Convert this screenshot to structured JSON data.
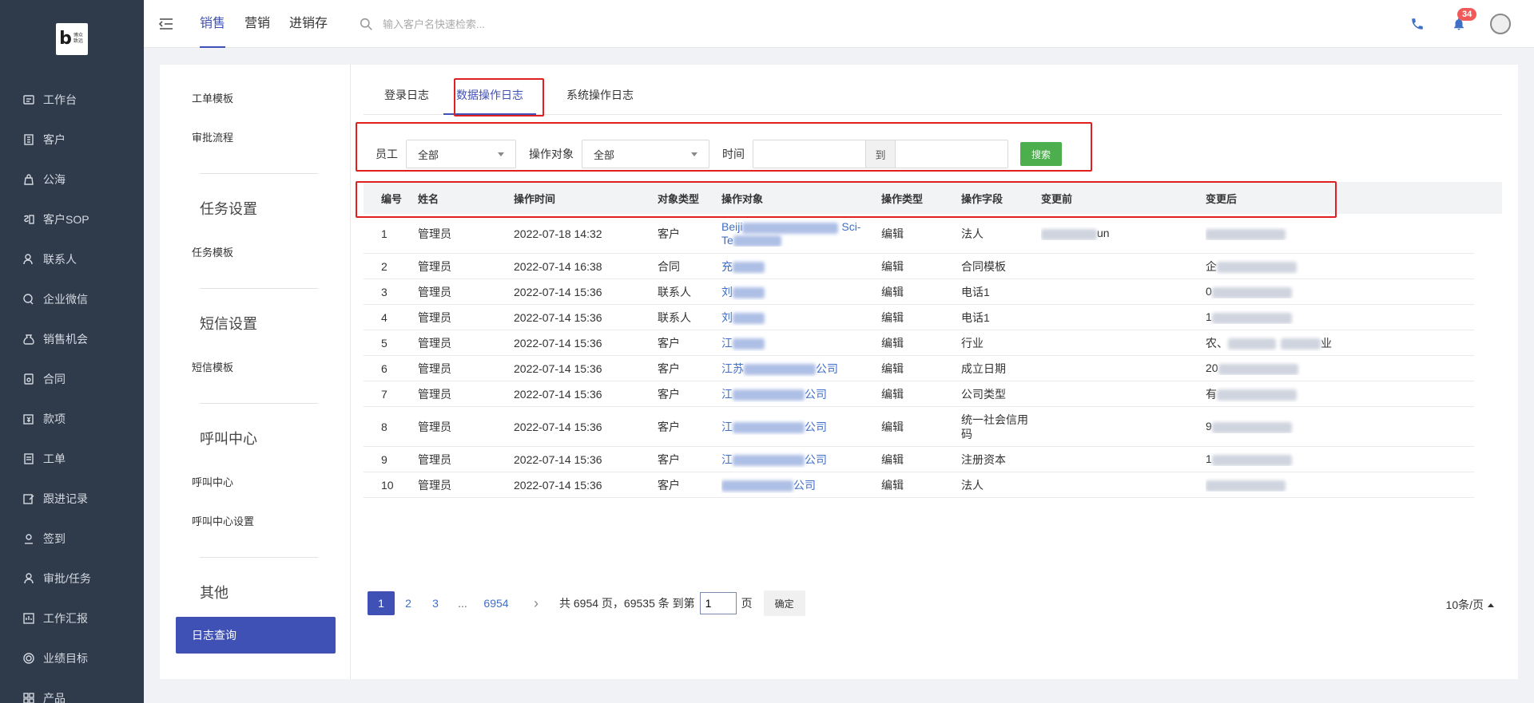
{
  "logo": {
    "letter": "b",
    "text": "博众致远"
  },
  "sidebar": {
    "items": [
      {
        "label": "工作台",
        "icon": "dashboard-icon"
      },
      {
        "label": "客户",
        "icon": "building-icon"
      },
      {
        "label": "公海",
        "icon": "bag-icon"
      },
      {
        "label": "客户SOP",
        "icon": "sop-icon"
      },
      {
        "label": "联系人",
        "icon": "person-icon"
      },
      {
        "label": "企业微信",
        "icon": "chat-icon"
      },
      {
        "label": "销售机会",
        "icon": "money-bag-icon"
      },
      {
        "label": "合同",
        "icon": "contract-icon"
      },
      {
        "label": "款项",
        "icon": "payment-icon"
      },
      {
        "label": "工单",
        "icon": "ticket-icon"
      },
      {
        "label": "跟进记录",
        "icon": "edit-icon"
      },
      {
        "label": "签到",
        "icon": "checkin-icon"
      },
      {
        "label": "审批/任务",
        "icon": "approval-icon"
      },
      {
        "label": "工作汇报",
        "icon": "report-icon"
      },
      {
        "label": "业绩目标",
        "icon": "target-icon"
      },
      {
        "label": "产品",
        "icon": "product-icon"
      }
    ]
  },
  "header": {
    "tabs": [
      "销售",
      "营销",
      "进销存"
    ],
    "active_tab": "销售",
    "search_placeholder": "输入客户名快速检索...",
    "notification_count": "34"
  },
  "submenu": {
    "links": {
      "work_order_template": "工单模板",
      "approval_flow": "审批流程",
      "task_template": "任务模板",
      "sms_template": "短信模板",
      "call_center": "呼叫中心",
      "call_center_settings": "呼叫中心设置"
    },
    "sections": {
      "task": "任务设置",
      "sms": "短信设置",
      "call": "呼叫中心",
      "other": "其他"
    },
    "active": "日志查询"
  },
  "log_tabs": [
    "登录日志",
    "数据操作日志",
    "系统操作日志"
  ],
  "filter": {
    "employee_label": "员工",
    "employee_value": "全部",
    "object_label": "操作对象",
    "object_value": "全部",
    "time_label": "时间",
    "to_label": "到",
    "search_button": "搜索"
  },
  "table": {
    "columns": [
      "编号",
      "姓名",
      "操作时间",
      "对象类型",
      "操作对象",
      "操作类型",
      "操作字段",
      "变更前",
      "变更后"
    ],
    "rows": [
      {
        "id": "1",
        "name": "管理员",
        "time": "2022-07-18 14:32",
        "obj_type": "客户",
        "obj_a": "Beiji",
        "obj_b": "Sci-",
        "obj_c": "Te",
        "op": "编辑",
        "field": "法人",
        "before": "un",
        "after": ""
      },
      {
        "id": "2",
        "name": "管理员",
        "time": "2022-07-14 16:38",
        "obj_type": "合同",
        "obj_a": "充",
        "obj_b": "",
        "obj_c": "",
        "op": "编辑",
        "field": "合同模板",
        "before": "",
        "after": "企"
      },
      {
        "id": "3",
        "name": "管理员",
        "time": "2022-07-14 15:36",
        "obj_type": "联系人",
        "obj_a": "刘",
        "obj_b": "",
        "obj_c": "",
        "op": "编辑",
        "field": "电话1",
        "before": "",
        "after": "0"
      },
      {
        "id": "4",
        "name": "管理员",
        "time": "2022-07-14 15:36",
        "obj_type": "联系人",
        "obj_a": "刘",
        "obj_b": "",
        "obj_c": "",
        "op": "编辑",
        "field": "电话1",
        "before": "",
        "after": "1"
      },
      {
        "id": "5",
        "name": "管理员",
        "time": "2022-07-14 15:36",
        "obj_type": "客户",
        "obj_a": "江",
        "obj_b": "",
        "obj_c": "",
        "op": "编辑",
        "field": "行业",
        "before": "",
        "after": "农、",
        "after_tail": "业"
      },
      {
        "id": "6",
        "name": "管理员",
        "time": "2022-07-14 15:36",
        "obj_type": "客户",
        "obj_a": "江苏",
        "obj_b": "公司",
        "obj_c": "",
        "op": "编辑",
        "field": "成立日期",
        "before": "",
        "after": "20"
      },
      {
        "id": "7",
        "name": "管理员",
        "time": "2022-07-14 15:36",
        "obj_type": "客户",
        "obj_a": "江",
        "obj_b": "公司",
        "obj_c": "",
        "op": "编辑",
        "field": "公司类型",
        "before": "",
        "after": "有"
      },
      {
        "id": "8",
        "name": "管理员",
        "time": "2022-07-14 15:36",
        "obj_type": "客户",
        "obj_a": "江",
        "obj_b": "公司",
        "obj_c": "",
        "op": "编辑",
        "field": "统一社会信用码",
        "before": "",
        "after": "9"
      },
      {
        "id": "9",
        "name": "管理员",
        "time": "2022-07-14 15:36",
        "obj_type": "客户",
        "obj_a": "江",
        "obj_b": "公司",
        "obj_c": "",
        "op": "编辑",
        "field": "注册资本",
        "before": "",
        "after": "1"
      },
      {
        "id": "10",
        "name": "管理员",
        "time": "2022-07-14 15:36",
        "obj_type": "客户",
        "obj_a": "",
        "obj_b": "公司",
        "obj_c": "",
        "op": "编辑",
        "field": "法人",
        "before": "",
        "after": ""
      }
    ]
  },
  "pagination": {
    "pages": [
      "1",
      "2",
      "3",
      "...",
      "6954"
    ],
    "current": "1",
    "next": "›",
    "summary": "共 6954 页，69535 条 到第",
    "input_value": "1",
    "page_unit": "页",
    "confirm": "确定",
    "page_size": "10条/页"
  },
  "colors": {
    "sidebar_bg": "#2f3a4b",
    "primary": "#3f51b5",
    "search_btn": "#4cae4c",
    "highlight_box": "#e02020",
    "badge": "#f25a5a"
  }
}
